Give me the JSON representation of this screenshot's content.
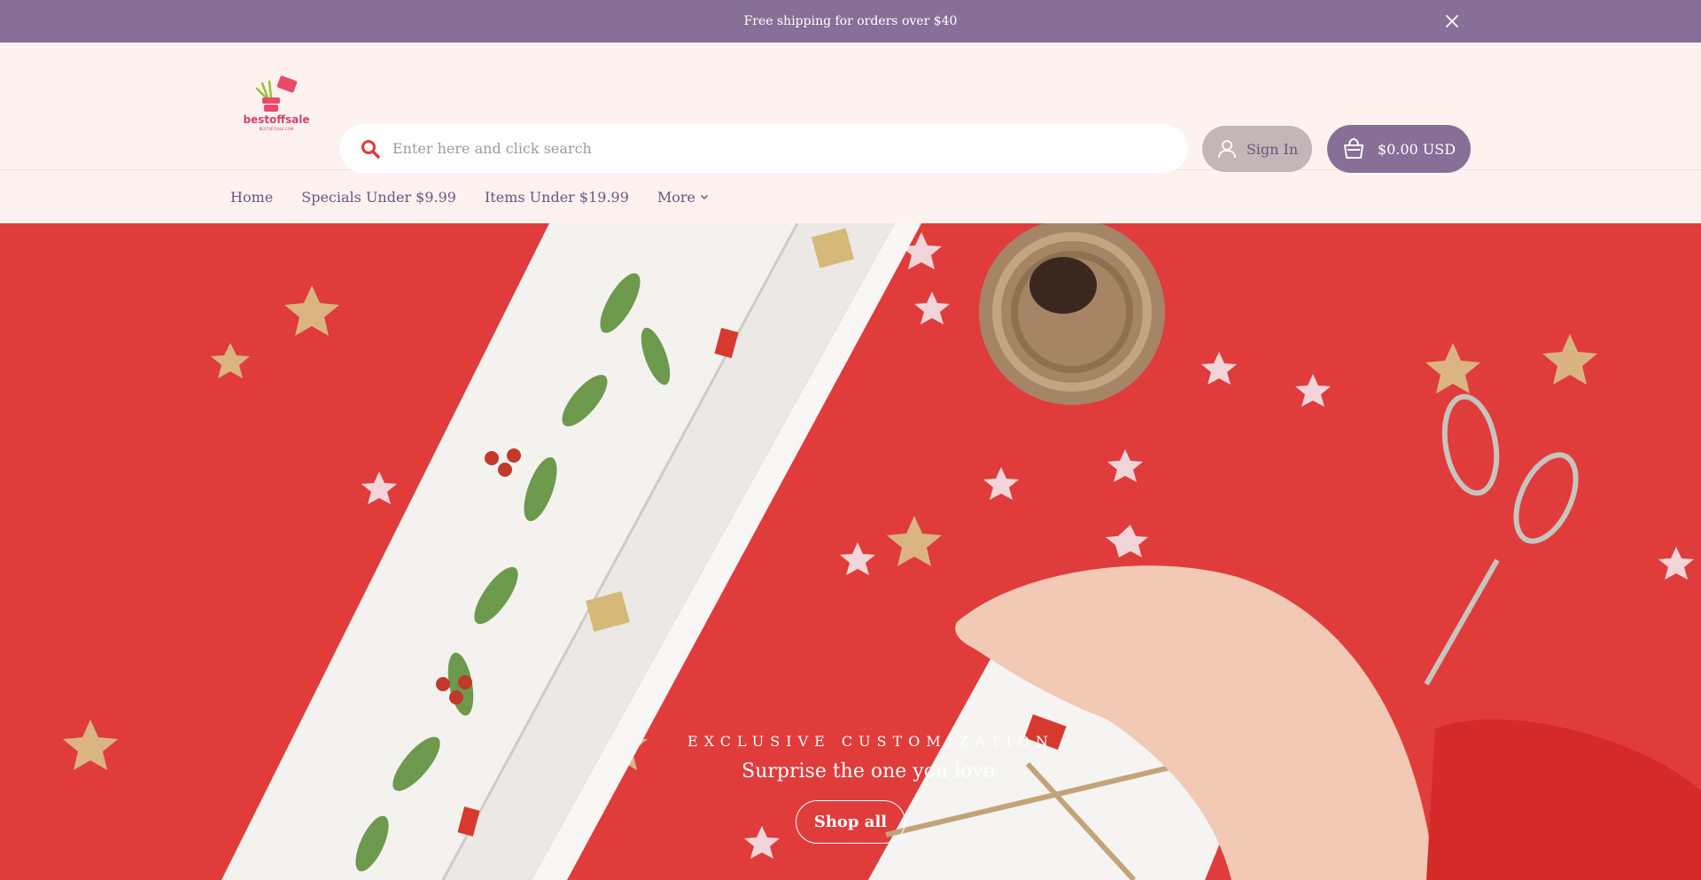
{
  "announcement": {
    "text": "Free shipping for orders over $40"
  },
  "header": {
    "logo_text": "bestoffsale",
    "logo_subtext": "BESTOFFSALE.COM",
    "search_placeholder": "Enter here and click search",
    "signin_label": "Sign In",
    "cart_label": "$0.00 USD"
  },
  "nav": {
    "items": [
      {
        "label": "Home"
      },
      {
        "label": "Specials Under $9.99"
      },
      {
        "label": "Items Under $19.99"
      },
      {
        "label": "More"
      }
    ]
  },
  "hero": {
    "kicker": "EXCLUSIVE CUSTOMIZATION",
    "headline": "Surprise the one you love",
    "cta": "Shop all"
  },
  "colors": {
    "accent": "#876f97",
    "background": "#fdf2f0",
    "search_icon": "#e03a3a",
    "hero_red": "#e03c3c"
  }
}
